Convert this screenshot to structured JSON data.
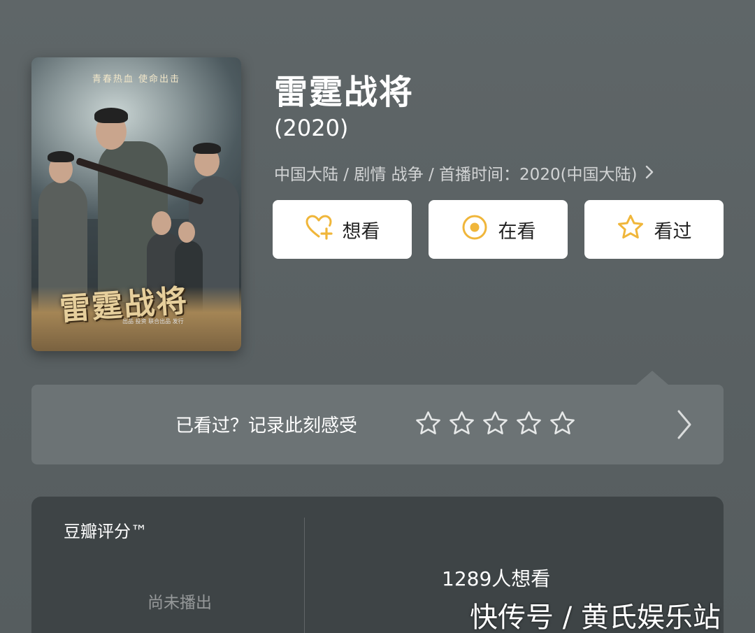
{
  "show": {
    "title": "雷霆战将",
    "year": "(2020)",
    "meta": "中国大陆 / 剧情 战争 / 首播时间：2020(中国大陆)",
    "poster": {
      "tagline": "青春热血  使命出击",
      "title_art": "雷霆战将",
      "credits": "出品  投资  联合出品  发行"
    }
  },
  "actions": {
    "want": "想看",
    "watching": "在看",
    "watched": "看过"
  },
  "rating_prompt": {
    "text": "已看过？记录此刻感受",
    "stars_selected": 0,
    "stars_total": 5
  },
  "score": {
    "label": "豆瓣评分™",
    "status": "尚未播出",
    "want_count": "1289人想看"
  },
  "watermark": "快传号 / 黄氏娱乐站",
  "colors": {
    "accent": "#f0b63a",
    "background": "#5d6466",
    "card": "#3e4446",
    "strip": "#6c7375"
  },
  "icons": {
    "want": "heart-plus-icon",
    "watching": "target-circle-icon",
    "watched": "star-outline-icon",
    "rating": "star-outline-icon",
    "more": "chevron-right-icon"
  }
}
